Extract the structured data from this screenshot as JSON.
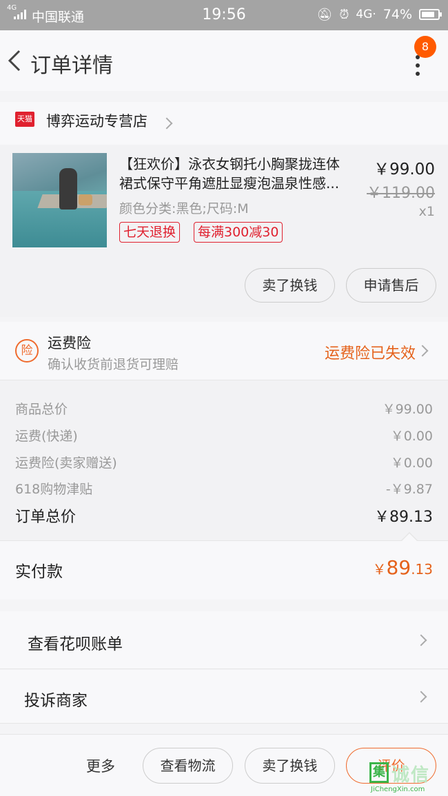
{
  "status_bar": {
    "network_type": "4G",
    "carrier": "中国联通",
    "time": "19:56",
    "network": "4G·",
    "battery": "74%"
  },
  "nav": {
    "title": "订单详情",
    "badge_count": "8"
  },
  "store": {
    "platform_logo": "天猫",
    "name": "博弈运动专营店"
  },
  "product": {
    "title_line1": "【狂欢价】泳衣女钢托小胸聚拢连体",
    "title_line2": "裙式保守平角遮肚显瘦泡温泉性感...",
    "spec": "颜色分类:黑色;尺码:M",
    "price": "￥99.00",
    "original_price": "￥119.00",
    "quantity": "x1",
    "tags": [
      "七天退换",
      "每满300减30"
    ],
    "actions": [
      "卖了换钱",
      "申请售后"
    ]
  },
  "insurance": {
    "icon_label": "险",
    "title": "运费险",
    "subtitle": "确认收货前退货可理赔",
    "status": "运费险已失效"
  },
  "summary": {
    "rows": [
      {
        "label": "商品总价",
        "value": "￥99.00"
      },
      {
        "label": "运费(快递)",
        "value": "￥0.00"
      },
      {
        "label": "运费险(卖家赠送)",
        "value": "￥0.00"
      },
      {
        "label": "618购物津贴",
        "value": "-￥9.87"
      }
    ],
    "total_label": "订单总价",
    "total_value": "￥89.13"
  },
  "paid": {
    "label": "实付款",
    "currency": "￥",
    "integer": "89",
    "decimal": ".13"
  },
  "links": {
    "huabei": "查看花呗账单",
    "complain": "投诉商家"
  },
  "bottom_bar": {
    "more": "更多",
    "logistics": "查看物流",
    "resell": "卖了换钱",
    "review": "评价"
  },
  "watermark": {
    "mark": "集",
    "text": "诚信",
    "url": "JiChengXin.com"
  },
  "colors": {
    "accent": "#e5621b",
    "tmall_red": "#e0212f",
    "badge": "#ff5a00"
  }
}
